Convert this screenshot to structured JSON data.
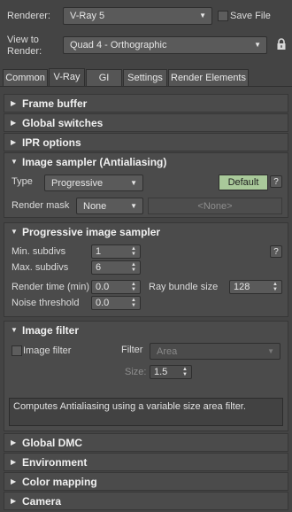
{
  "header": {
    "renderer_label": "Renderer:",
    "renderer_value": "V-Ray 5",
    "save_file_label": "Save File",
    "view_label_line1": "View to",
    "view_label_line2": "Render:",
    "view_value": "Quad 4 - Orthographic"
  },
  "tabs": [
    {
      "label": "Common"
    },
    {
      "label": "V-Ray"
    },
    {
      "label": "GI"
    },
    {
      "label": "Settings"
    },
    {
      "label": "Render Elements"
    }
  ],
  "active_tab": "V-Ray",
  "rollouts": {
    "frame_buffer": "Frame buffer",
    "global_switches": "Global switches",
    "ipr_options": "IPR options",
    "image_sampler": "Image sampler (Antialiasing)",
    "progressive_sampler": "Progressive image sampler",
    "image_filter": "Image filter",
    "global_dmc": "Global DMC",
    "environment": "Environment",
    "color_mapping": "Color mapping",
    "camera": "Camera"
  },
  "image_sampler": {
    "type_label": "Type",
    "type_value": "Progressive",
    "default_button": "Default",
    "help": "?",
    "render_mask_label": "Render mask",
    "render_mask_value": "None",
    "render_mask_target": "<None>"
  },
  "progressive": {
    "min_subdivs_label": "Min. subdivs",
    "min_subdivs_value": "1",
    "max_subdivs_label": "Max. subdivs",
    "max_subdivs_value": "6",
    "render_time_label": "Render time (min)",
    "render_time_value": "0.0",
    "ray_bundle_label": "Ray bundle size",
    "ray_bundle_value": "128",
    "noise_threshold_label": "Noise threshold",
    "noise_threshold_value": "0.0",
    "help": "?"
  },
  "image_filter": {
    "checkbox_label": "Image filter",
    "checked": false,
    "filter_label": "Filter",
    "filter_value": "Area",
    "size_label": "Size:",
    "size_value": "1.5",
    "description": "Computes Antialiasing using a variable size area filter."
  },
  "colors": {
    "background": "#444444",
    "panel": "#4b4b4b",
    "default_button": "#a9c99a"
  }
}
